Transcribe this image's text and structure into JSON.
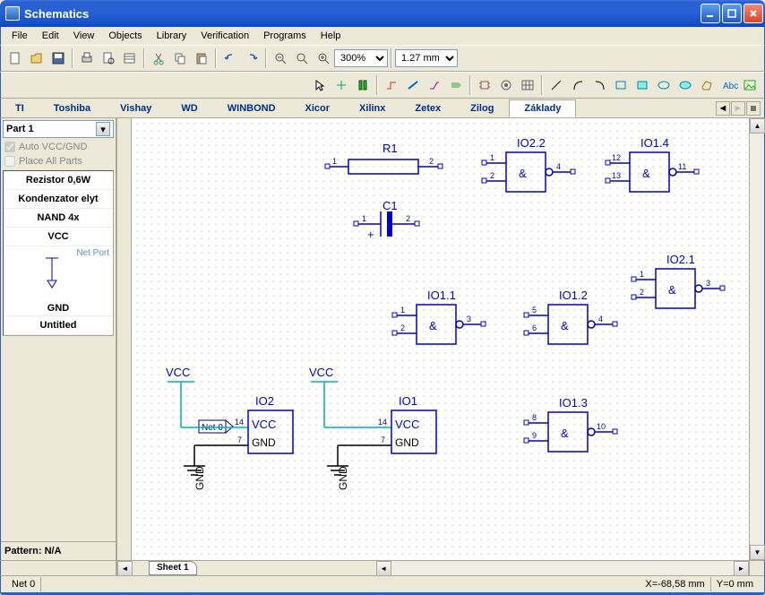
{
  "window": {
    "title": "Schematics"
  },
  "menu": {
    "file": "File",
    "edit": "Edit",
    "view": "View",
    "objects": "Objects",
    "library": "Library",
    "verification": "Verification",
    "programs": "Programs",
    "help": "Help"
  },
  "toolbar": {
    "zoom_value": "300%",
    "grid_value": "1.27 mm"
  },
  "libtabs": [
    "TI",
    "Toshiba",
    "Vishay",
    "WD",
    "WINBOND",
    "Xicor",
    "Xilinx",
    "Zetex",
    "Zilog",
    "Základy"
  ],
  "libtabs_active_index": 9,
  "sidebar": {
    "part_selector": "Part 1",
    "auto_vcc": "Auto VCC/GND",
    "place_all": "Place All Parts",
    "items": [
      "Rezistor 0,6W",
      "Kondenzator elyt",
      "NAND 4x",
      "VCC"
    ],
    "net_port_label": "Net Port",
    "gnd_label": "GND",
    "untitled": "Untitled",
    "pattern": "Pattern: N/A"
  },
  "canvas": {
    "labels": {
      "R1": "R1",
      "C1": "C1",
      "IO1": "IO1",
      "IO2": "IO2",
      "IO1_1": "IO1.1",
      "IO1_2": "IO1.2",
      "IO1_3": "IO1.3",
      "IO1_4": "IO1.4",
      "IO2_1": "IO2.1",
      "IO2_2": "IO2.2",
      "VCC": "VCC",
      "GND": "GND",
      "Net0": "Net 0",
      "amp": "&"
    }
  },
  "sheet_tab": "Sheet 1",
  "statusbar": {
    "left": "Net 0",
    "x": "X=-68,58 mm",
    "y": "Y=0 mm"
  }
}
